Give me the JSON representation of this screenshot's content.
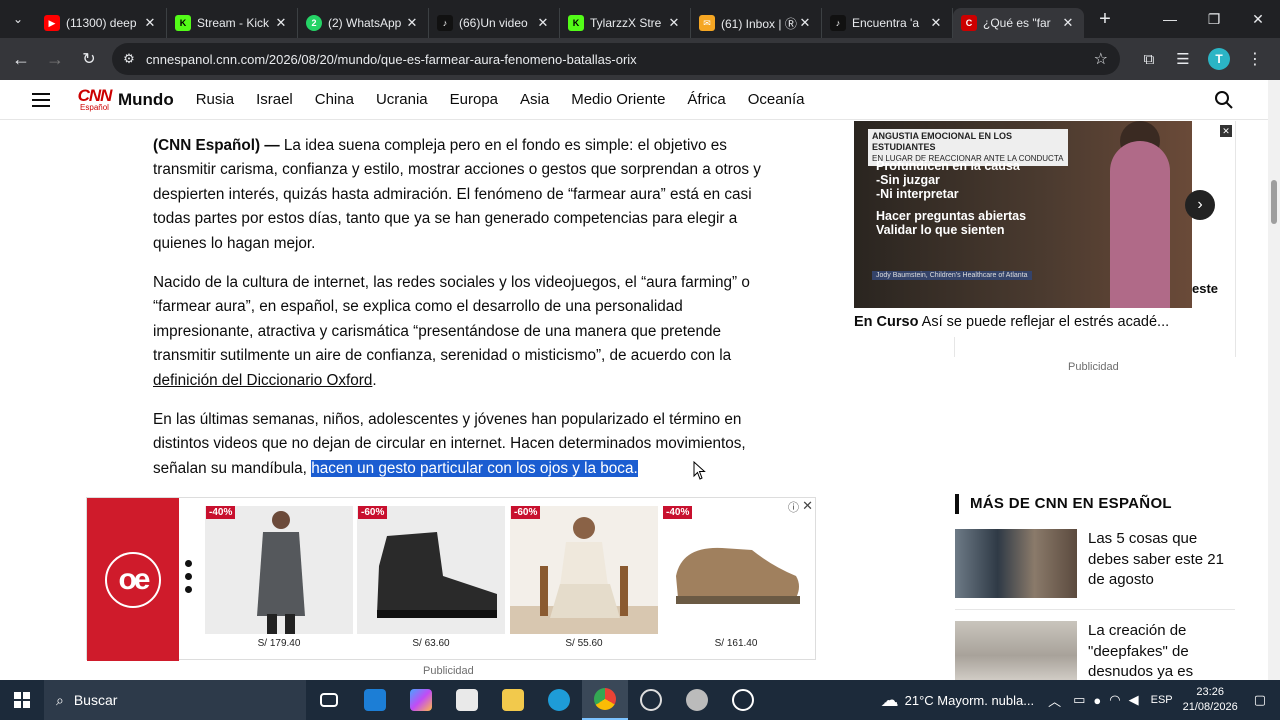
{
  "browser": {
    "tabs": [
      {
        "title": "(11300) deep",
        "favicon_color": "#ff0000",
        "favicon_glyph": "▶"
      },
      {
        "title": "Stream - Kick",
        "favicon_color": "#53fc18",
        "favicon_glyph": "K"
      },
      {
        "title": "(2) WhatsApp",
        "favicon_color": "#25d366",
        "favicon_glyph": "2"
      },
      {
        "title": "(66)Un video",
        "favicon_color": "#111111",
        "favicon_glyph": "♪"
      },
      {
        "title": "TylarzzX Stre",
        "favicon_color": "#53fc18",
        "favicon_glyph": "K"
      },
      {
        "title": "(61) Inbox | Ⓡ",
        "favicon_color": "#f5a623",
        "favicon_glyph": "✉"
      },
      {
        "title": "Encuentra 'a",
        "favicon_color": "#111111",
        "favicon_glyph": "♪"
      },
      {
        "title": "¿Qué es \"far",
        "favicon_color": "#cc0000",
        "favicon_glyph": "C"
      }
    ],
    "url": "cnnespanol.cnn.com/2026/08/20/mundo/que-es-farmear-aura-fenomeno-batallas-orix",
    "avatar_letter": "T"
  },
  "site": {
    "logo_text": "CNN",
    "logo_sub": "Español",
    "section": "Mundo",
    "nav": [
      "Rusia",
      "Israel",
      "China",
      "Ucrania",
      "Europa",
      "Asia",
      "Medio Oriente",
      "África",
      "Oceanía"
    ]
  },
  "article": {
    "p1_lead": "(CNN Español) —",
    "p1_body": " La idea suena compleja pero en el fondo es simple: el objetivo es transmitir carisma, confianza y estilo, mostrar acciones o gestos que sorprendan a otros y despierten interés, quizás hasta admiración. El fenómeno de “farmear aura” está en casi todas partes por estos días, tanto que ya se han generado competencias para elegir a quienes lo hagan mejor.",
    "p2_body": "Nacido de la cultura de internet, las redes sociales y los videojuegos, el “aura farming” o “farmear aura”, en español, se explica como el desarrollo de una personalidad impresionante, atractiva y carismática “presentándose de una manera que pretende transmitir sutilmente un aire de confianza, serenidad o misticismo”, de acuerdo con la ",
    "p2_link": "definición del Diccionario Oxford",
    "p2_end": ".",
    "p3_body": "En las últimas semanas, niños, adolescentes y jóvenes han popularizado el término en distintos videos que no dejan de circular en internet. Hacen determinados movimientos, señalan su mandíbula, ",
    "p3_selected": "hacen un gesto particular con los ojos y la boca."
  },
  "video": {
    "banner_line1": "ANGUSTIA EMOCIONAL EN LOS ESTUDIANTES",
    "banner_line2": "EN LUGAR DE REACCIONAR ANTE LA CONDUCTA",
    "lines": [
      "Profundicen en la causa",
      "-Sin juzgar",
      "-Ni interpretar",
      "Hacer preguntas abiertas",
      "Validar lo que sienten"
    ],
    "credit": "Jody Baumstein, Children's Healthcare of Atlanta",
    "caption_label": "En Curso",
    "caption_text": " Así se puede reflejar el estrés acadé...",
    "peek_text": "este"
  },
  "ads": {
    "side_label": "Publicidad",
    "bottom_label": "Publicidad",
    "brand": "oe",
    "products": [
      {
        "discount": "-40%",
        "price": "S/ 179.40",
        "kind": "coat"
      },
      {
        "discount": "-60%",
        "price": "S/ 63.60",
        "kind": "boot"
      },
      {
        "discount": "-60%",
        "price": "S/ 55.60",
        "kind": "man-seated"
      },
      {
        "discount": "-40%",
        "price": "S/ 161.40",
        "kind": "shoe"
      }
    ]
  },
  "more": {
    "title": "MÁS DE CNN EN ESPAÑOL",
    "stories": [
      {
        "headline": "Las 5 cosas que debes saber este 21 de agosto"
      },
      {
        "headline": "La creación de \"deepfakes\" de desnudos ya es"
      }
    ]
  },
  "taskbar": {
    "search_placeholder": "Buscar",
    "weather": "21°C  Mayorm. nubla...",
    "lang": "ESP",
    "time": "23:26",
    "date": "21/08/2026"
  },
  "colors": {
    "cnn_red": "#cc0000",
    "selection_blue": "#1b5dd1",
    "chrome_dark": "#202124",
    "ad_brand_red": "#cf1b2b"
  }
}
